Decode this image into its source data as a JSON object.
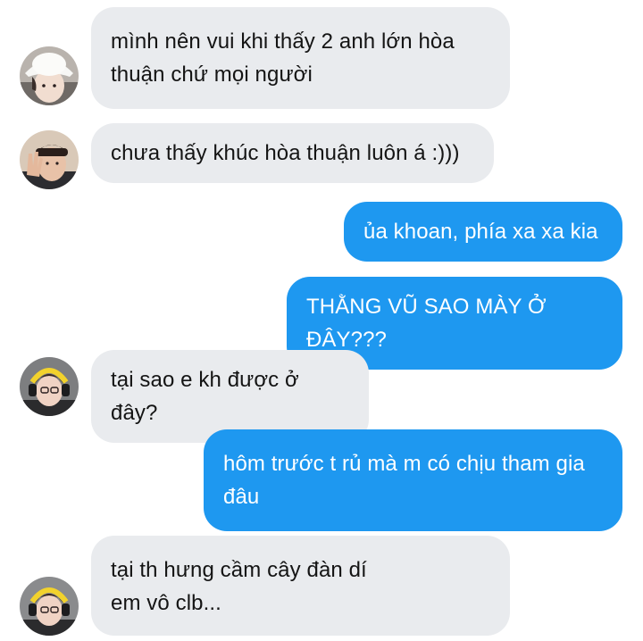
{
  "conversation": {
    "messages": [
      {
        "side": "incoming",
        "avatar": "avatar-bucket-hat-icon",
        "text": "mình nên vui khi thấy 2 anh lớn hòa thuận chứ mọi người"
      },
      {
        "side": "incoming",
        "avatar": "avatar-waving-boy-icon",
        "text": "chưa thấy khúc hòa thuận luôn á :)))"
      },
      {
        "side": "outgoing",
        "text": "ủa khoan, phía xa xa kia"
      },
      {
        "side": "outgoing",
        "text": "THẰNG VŨ SAO MÀY Ở ĐÂY???"
      },
      {
        "side": "incoming",
        "avatar": "avatar-headset-icon",
        "text": "tại sao e kh được ở đây?"
      },
      {
        "side": "outgoing",
        "text": "hôm trước t rủ mà m có chịu tham gia đâu"
      },
      {
        "side": "incoming",
        "avatar": "avatar-headset-icon",
        "text": "tại th hưng cầm cây đàn dí em vô clb..."
      }
    ]
  },
  "colors": {
    "incoming_bubble": "#e9ebee",
    "incoming_text": "#141414",
    "outgoing_bubble": "#1e98f0",
    "outgoing_text": "#ffffff",
    "background": "#ffffff"
  }
}
